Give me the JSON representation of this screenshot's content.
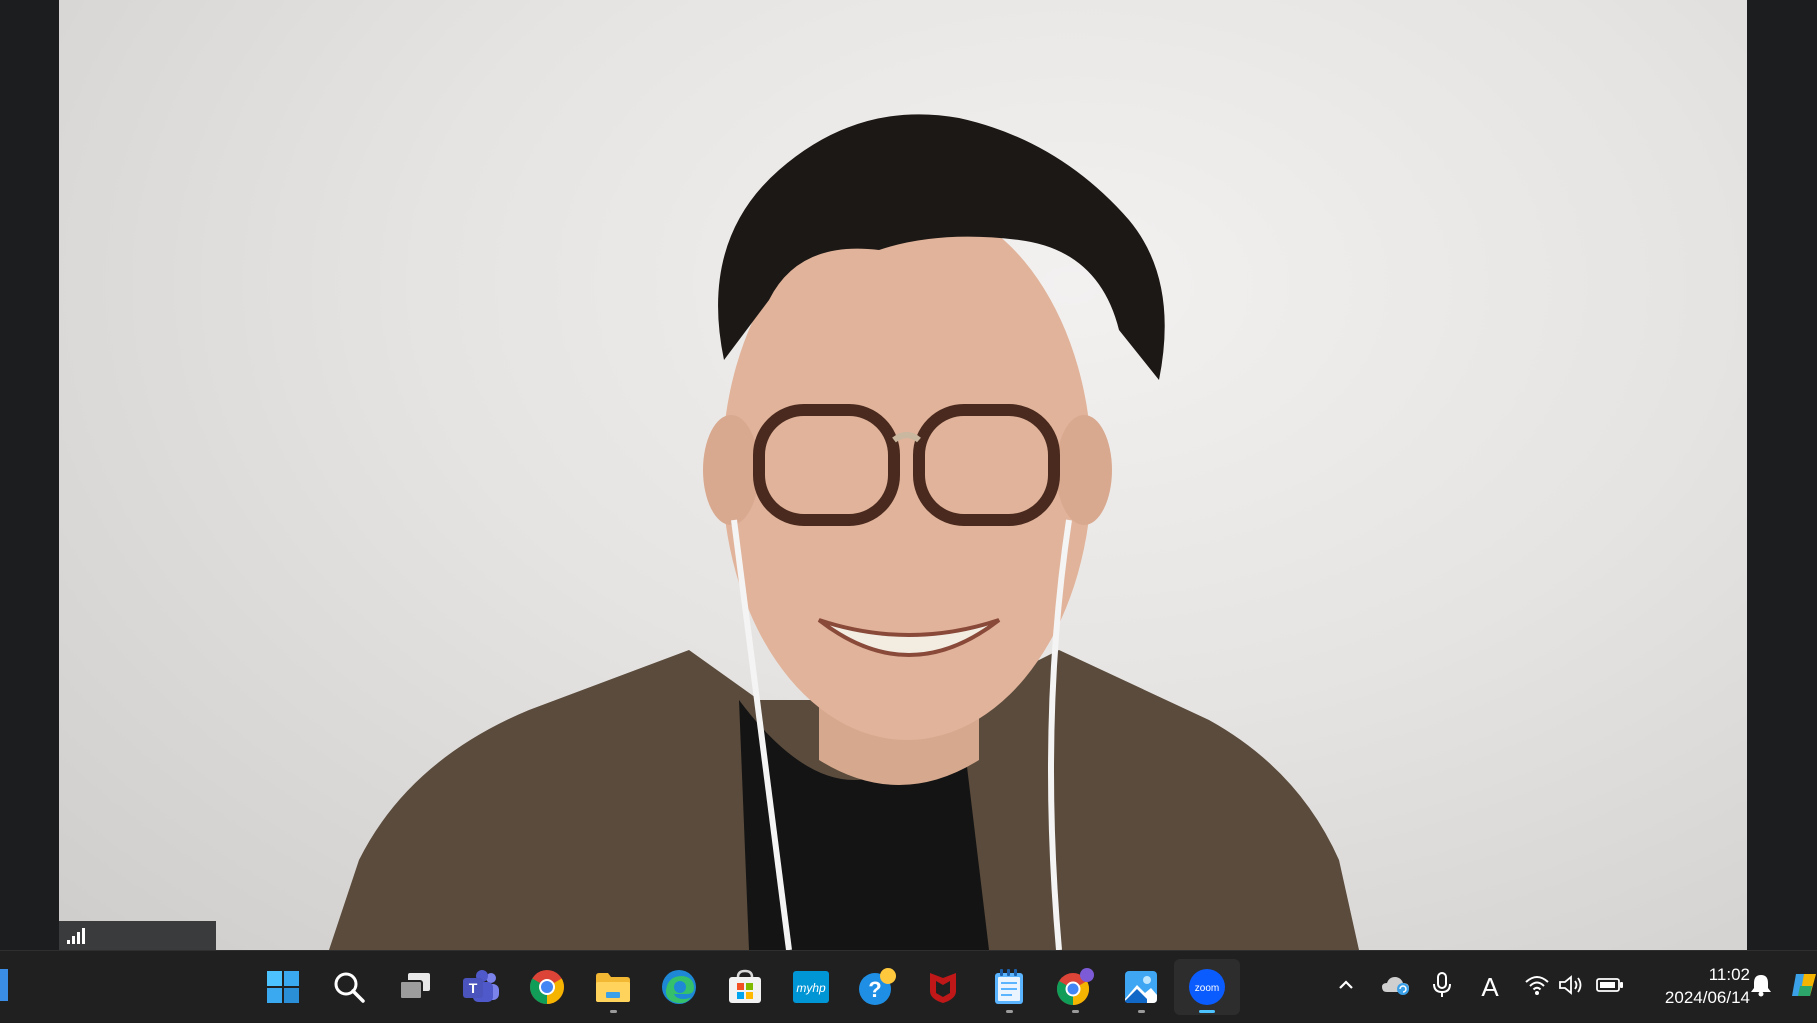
{
  "window": {
    "title": ""
  },
  "video": {
    "participant_name": "",
    "background_color": "#e9e7e5"
  },
  "signal": {
    "icon": "signal-strength-icon",
    "bars": 4
  },
  "taskbar": {
    "apps": [
      {
        "name": "start",
        "icon": "windows-start-icon",
        "running": false
      },
      {
        "name": "search",
        "icon": "search-icon",
        "running": false
      },
      {
        "name": "task-view",
        "icon": "task-view-icon",
        "running": false
      },
      {
        "name": "teams",
        "icon": "teams-icon",
        "running": false
      },
      {
        "name": "chrome",
        "icon": "chrome-icon",
        "running": false
      },
      {
        "name": "file-explorer",
        "icon": "folder-icon",
        "running": true
      },
      {
        "name": "edge",
        "icon": "edge-icon",
        "running": false
      },
      {
        "name": "microsoft-store",
        "icon": "store-icon",
        "running": false
      },
      {
        "name": "myhp",
        "icon": "myhp-icon",
        "label": "myhp",
        "running": false
      },
      {
        "name": "get-help",
        "icon": "help-icon",
        "running": false
      },
      {
        "name": "mcafee",
        "icon": "mcafee-icon",
        "running": false
      },
      {
        "name": "notepad",
        "icon": "notepad-icon",
        "running": true
      },
      {
        "name": "chrome-profile",
        "icon": "chrome-icon",
        "running": true
      },
      {
        "name": "photos",
        "icon": "photos-icon",
        "running": true
      },
      {
        "name": "zoom",
        "icon": "zoom-icon",
        "label": "zoom",
        "running": true,
        "active": true
      }
    ],
    "tray": {
      "icons": [
        "chevron-up-icon",
        "onedrive-icon",
        "microphone-icon",
        "ime-icon",
        "wifi-icon",
        "volume-icon",
        "battery-icon",
        "bell-icon",
        "copilot-icon"
      ],
      "ime_label": "A",
      "time": "11:02",
      "date": "2024/06/14"
    }
  },
  "colors": {
    "taskbar_bg": "#202020",
    "accent": "#4cc2ff",
    "zoom_blue": "#0b5cff"
  }
}
